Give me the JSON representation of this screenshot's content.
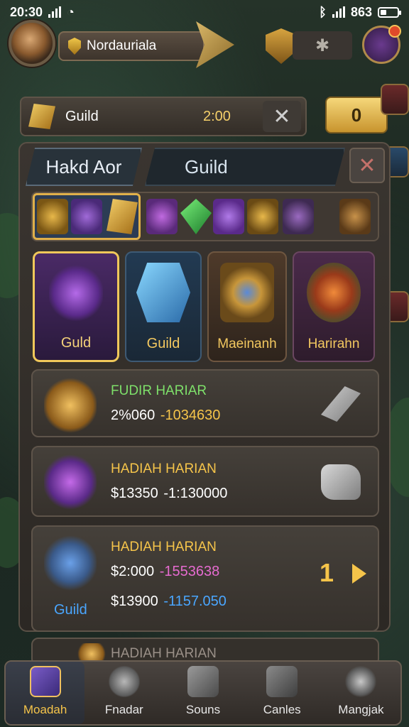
{
  "status": {
    "time": "20:30",
    "percent": "863"
  },
  "player": {
    "name": "Nordauriala"
  },
  "guild_bar": {
    "label": "Guild",
    "timer": "2:00",
    "gold_count": "0"
  },
  "tabs": {
    "left": "Hakd Aor",
    "right": "Guild"
  },
  "categories": [
    {
      "label": "Guld"
    },
    {
      "label": "Guild"
    },
    {
      "label": "Maeinanh"
    },
    {
      "label": "Harirahn"
    }
  ],
  "rewards": [
    {
      "title": "FUDIR HARIAR",
      "title_color": "#7ee06a",
      "value_a": "2%060",
      "value_b": "-1034630",
      "value_b_color": "#f5c44a"
    },
    {
      "title": "HADIAH HARIAN",
      "title_color": "#f5c44a",
      "value_a": "$13350",
      "value_b": "-1:130000",
      "value_b_color": "#ffffff"
    },
    {
      "title": "HADIAH HARIAN",
      "title_color": "#f5c44a",
      "value_a": "$2:000",
      "value_b": "-1553638",
      "value_b_color": "#e66bd0",
      "value_c": "$13900",
      "value_d": "-1157.050",
      "value_d_color": "#4aa6ff",
      "icon_label": "Guild",
      "badge": "1"
    },
    {
      "title": "HADIAH HARIAN",
      "title_color": "#9a9088"
    }
  ],
  "nav": [
    {
      "label": "Moadah",
      "active": true
    },
    {
      "label": "Fnadar",
      "active": false
    },
    {
      "label": "Souns",
      "active": false
    },
    {
      "label": "Canles",
      "active": false
    },
    {
      "label": "Mangjak",
      "active": false
    }
  ]
}
